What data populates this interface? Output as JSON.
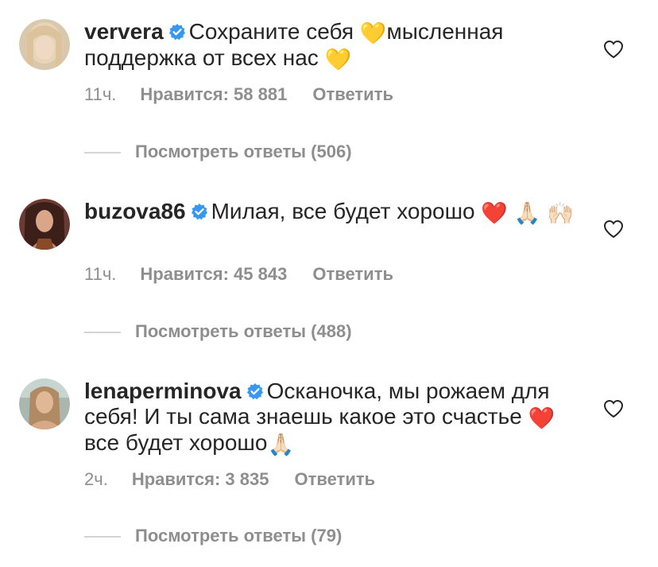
{
  "icons": {
    "verified": "verified-badge-icon",
    "like": "heart-outline-icon"
  },
  "colors": {
    "verified_blue": "#3897f0",
    "meta_gray": "#8e8e8e",
    "heart_red": "#e0162b",
    "yellow_heart": "#f4c21b"
  },
  "comments": [
    {
      "username": "ververa",
      "text_parts": [
        "Сохраните себя ",
        "💛",
        "мысленная поддержка от всех нас ",
        "💛"
      ],
      "time": "11ч.",
      "likes": "Нравится: 58 881",
      "reply": "Ответить",
      "view_replies": "Посмотреть ответы (506)"
    },
    {
      "username": "buzova86",
      "text_parts": [
        "Милая, все будет хорошо ",
        "❤️",
        "🙏🏻",
        "🙌🏻"
      ],
      "time": "11ч.",
      "likes": "Нравится: 45 843",
      "reply": "Ответить",
      "view_replies": "Посмотреть ответы (488)"
    },
    {
      "username": "lenaperminova",
      "text_parts": [
        "Осканочка, мы рожаем для себя! И ты сама знаешь какое это счастье ",
        "❤️",
        " все будет хорошо",
        "🙏🏻"
      ],
      "time": "2ч.",
      "likes": "Нравится: 3 835",
      "reply": "Ответить",
      "view_replies": "Посмотреть ответы (79)"
    }
  ]
}
